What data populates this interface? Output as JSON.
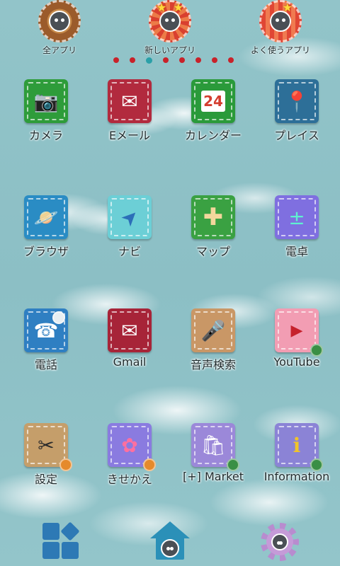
{
  "top_shortcuts": [
    {
      "label": "全アプリ",
      "icon": "penguin-donut-icon"
    },
    {
      "label": "新しいアプリ",
      "icon": "penguin-stars-icon"
    },
    {
      "label": "よく使うアプリ",
      "icon": "penguin-stripes-icon"
    }
  ],
  "page_indicator": {
    "count": 8,
    "active_index": 2
  },
  "apps": [
    {
      "label": "カメラ",
      "icon": "camera-icon",
      "color": "#2e9c3a",
      "glyph": "📷"
    },
    {
      "label": "Eメール",
      "icon": "email-icon",
      "color": "#b22a3e",
      "glyph": "✉"
    },
    {
      "label": "カレンダー",
      "icon": "calendar-icon",
      "color": "#2a9a3a",
      "glyph": "24"
    },
    {
      "label": "プレイス",
      "icon": "map-pin-icon",
      "color": "#2d6f98",
      "glyph": "📍"
    },
    {
      "label": "ブラウザ",
      "icon": "planet-icon",
      "color": "#2a8cc4",
      "glyph": "🪐"
    },
    {
      "label": "ナビ",
      "icon": "compass-icon",
      "color": "#6ccfd6",
      "glyph": "➤"
    },
    {
      "label": "マップ",
      "icon": "bandage-icon",
      "color": "#3aa142",
      "glyph": "✚"
    },
    {
      "label": "電卓",
      "icon": "calculator-icon",
      "color": "#7f6fe0",
      "glyph": "±"
    },
    {
      "label": "電話",
      "icon": "phone-icon",
      "color": "#2f7fc2",
      "glyph": "☎"
    },
    {
      "label": "Gmail",
      "icon": "gmail-icon",
      "color": "#a72438",
      "glyph": "✉"
    },
    {
      "label": "音声検索",
      "icon": "microphone-icon",
      "color": "#c99766",
      "glyph": "🎤"
    },
    {
      "label": "YouTube",
      "icon": "youtube-icon",
      "color": "#f29db3",
      "glyph": "▶"
    },
    {
      "label": "設定",
      "icon": "tools-icon",
      "color": "#c59e6a",
      "glyph": "✂"
    },
    {
      "label": "きせかえ",
      "icon": "puzzle-icon",
      "color": "#8a7be0",
      "glyph": "✿"
    },
    {
      "label": "[+] Market",
      "icon": "shopping-bag-icon",
      "color": "#9b88d9",
      "glyph": "🛍"
    },
    {
      "label": "Information",
      "icon": "info-icon",
      "color": "#8b83d6",
      "glyph": "i"
    }
  ],
  "dock": [
    {
      "name": "app-drawer-icon"
    },
    {
      "name": "home-penguin-icon"
    },
    {
      "name": "settings-gear-icon"
    }
  ]
}
